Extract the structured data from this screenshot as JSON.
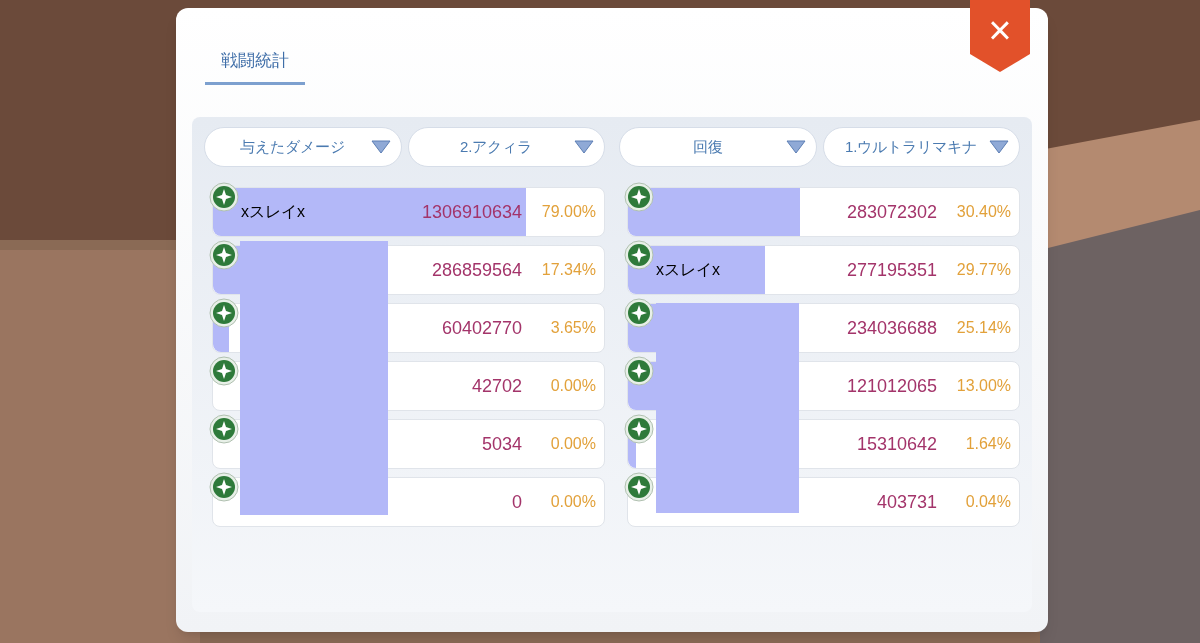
{
  "dialog": {
    "tab": {
      "label": "戦闘統計",
      "selected": true
    },
    "close": "×"
  },
  "left": {
    "filters": [
      "与えたダメージ",
      "2.アクィラ"
    ],
    "rows": [
      {
        "name": "xスレイx",
        "value": "1306910634",
        "percent": "79.00%",
        "level": 0.8
      },
      {
        "value": "286859564",
        "percent": "17.34%",
        "level": 0.17
      },
      {
        "value": "60402770",
        "percent": "3.65%",
        "level": 0.04
      },
      {
        "value": "42702",
        "percent": "0.00%",
        "level": 0
      },
      {
        "value": "5034",
        "percent": "0.00%",
        "level": 0
      },
      {
        "value": "0",
        "percent": "0.00%",
        "level": 0
      }
    ]
  },
  "right": {
    "filters": [
      "回復",
      "1.ウルトラリマキナ"
    ],
    "rows": [
      {
        "value": "283072302",
        "percent": "30.40%",
        "level": 0.44
      },
      {
        "name": "xスレイx",
        "value": "277195351",
        "percent": "29.77%",
        "level": 0.35
      },
      {
        "value": "234036688",
        "percent": "25.14%",
        "level": 0.25
      },
      {
        "value": "121012065",
        "percent": "13.00%",
        "level": 0.13
      },
      {
        "value": "15310642",
        "percent": "1.64%",
        "level": 0.02
      },
      {
        "value": "403731",
        "percent": "0.04%",
        "level": 0
      }
    ]
  }
}
